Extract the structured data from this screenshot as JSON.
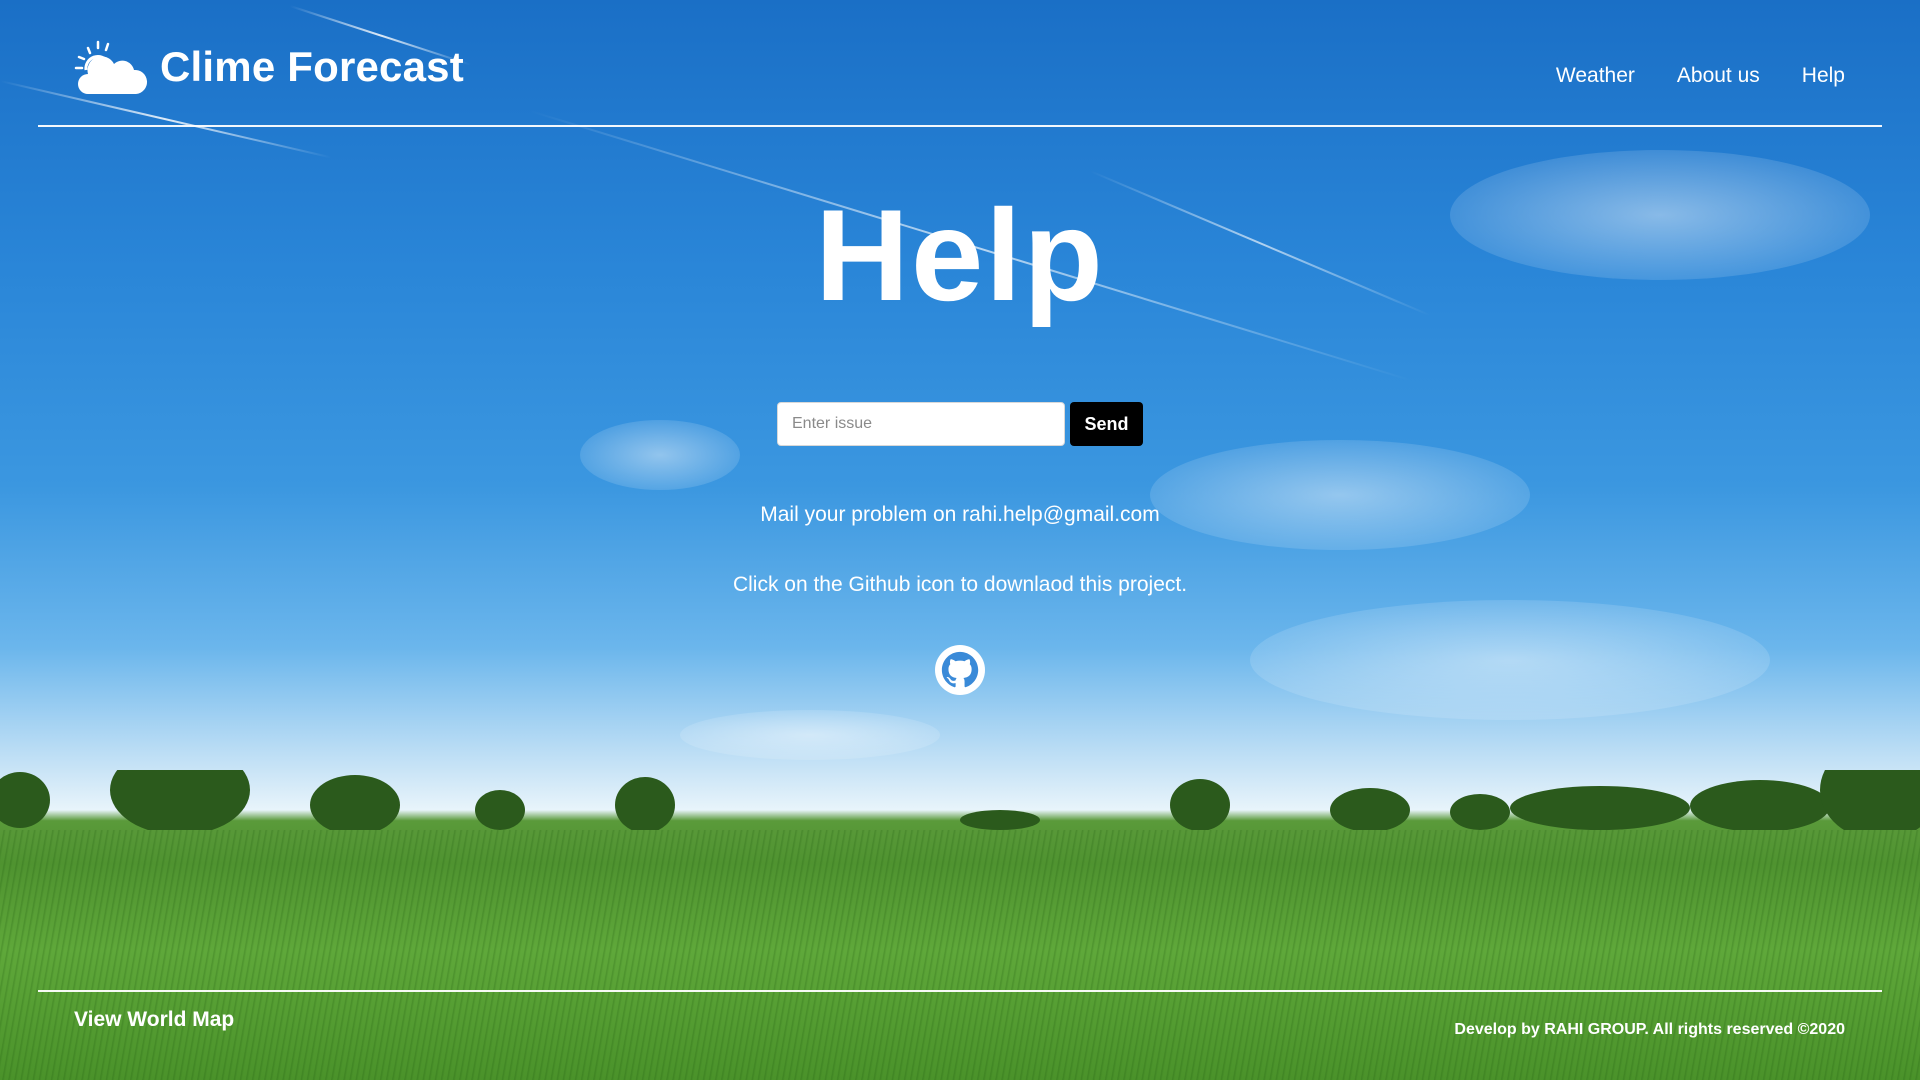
{
  "brand": {
    "title": "Clime Forecast",
    "icon": "sun-cloud-icon"
  },
  "nav": {
    "items": [
      "Weather",
      "About us",
      "Help"
    ]
  },
  "main": {
    "title": "Help",
    "issue_input": {
      "placeholder": "Enter issue",
      "value": ""
    },
    "send_label": "Send",
    "mail_text": "Mail your problem on rahi.help@gmail.com",
    "github_text": "Click on the Github icon to downlaod this project.",
    "github_icon": "github-icon"
  },
  "footer": {
    "map_link": "View World Map",
    "copyright": "Develop by RAHI GROUP. All rights reserved ©2020"
  },
  "colors": {
    "text": "#ffffff",
    "button_bg": "#000000",
    "sky_top": "#1a6fc6",
    "grass": "#4f9330"
  }
}
